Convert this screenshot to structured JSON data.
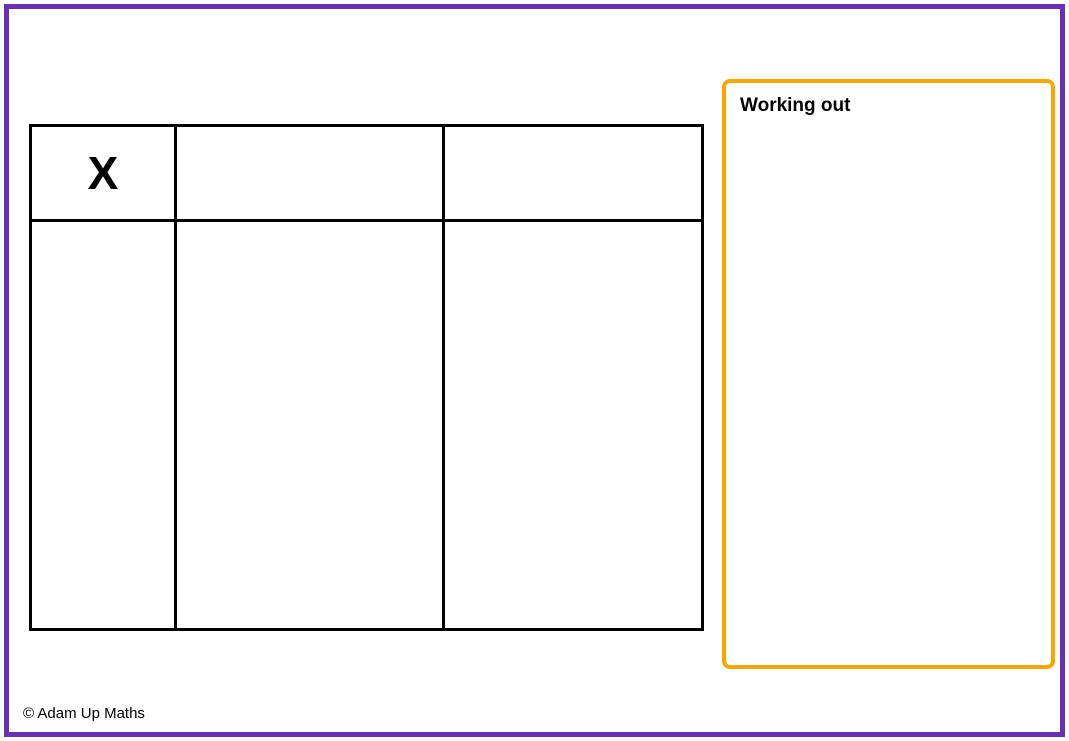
{
  "grid": {
    "operator": "X",
    "header_cells": [
      "",
      ""
    ],
    "rows": [
      {
        "label": "",
        "cells": [
          "",
          ""
        ]
      }
    ]
  },
  "working_out": {
    "title": "Working out"
  },
  "footer": {
    "copyright": "© Adam Up Maths"
  },
  "colors": {
    "frame": "#6b2fb3",
    "working_border": "#f7a800"
  }
}
